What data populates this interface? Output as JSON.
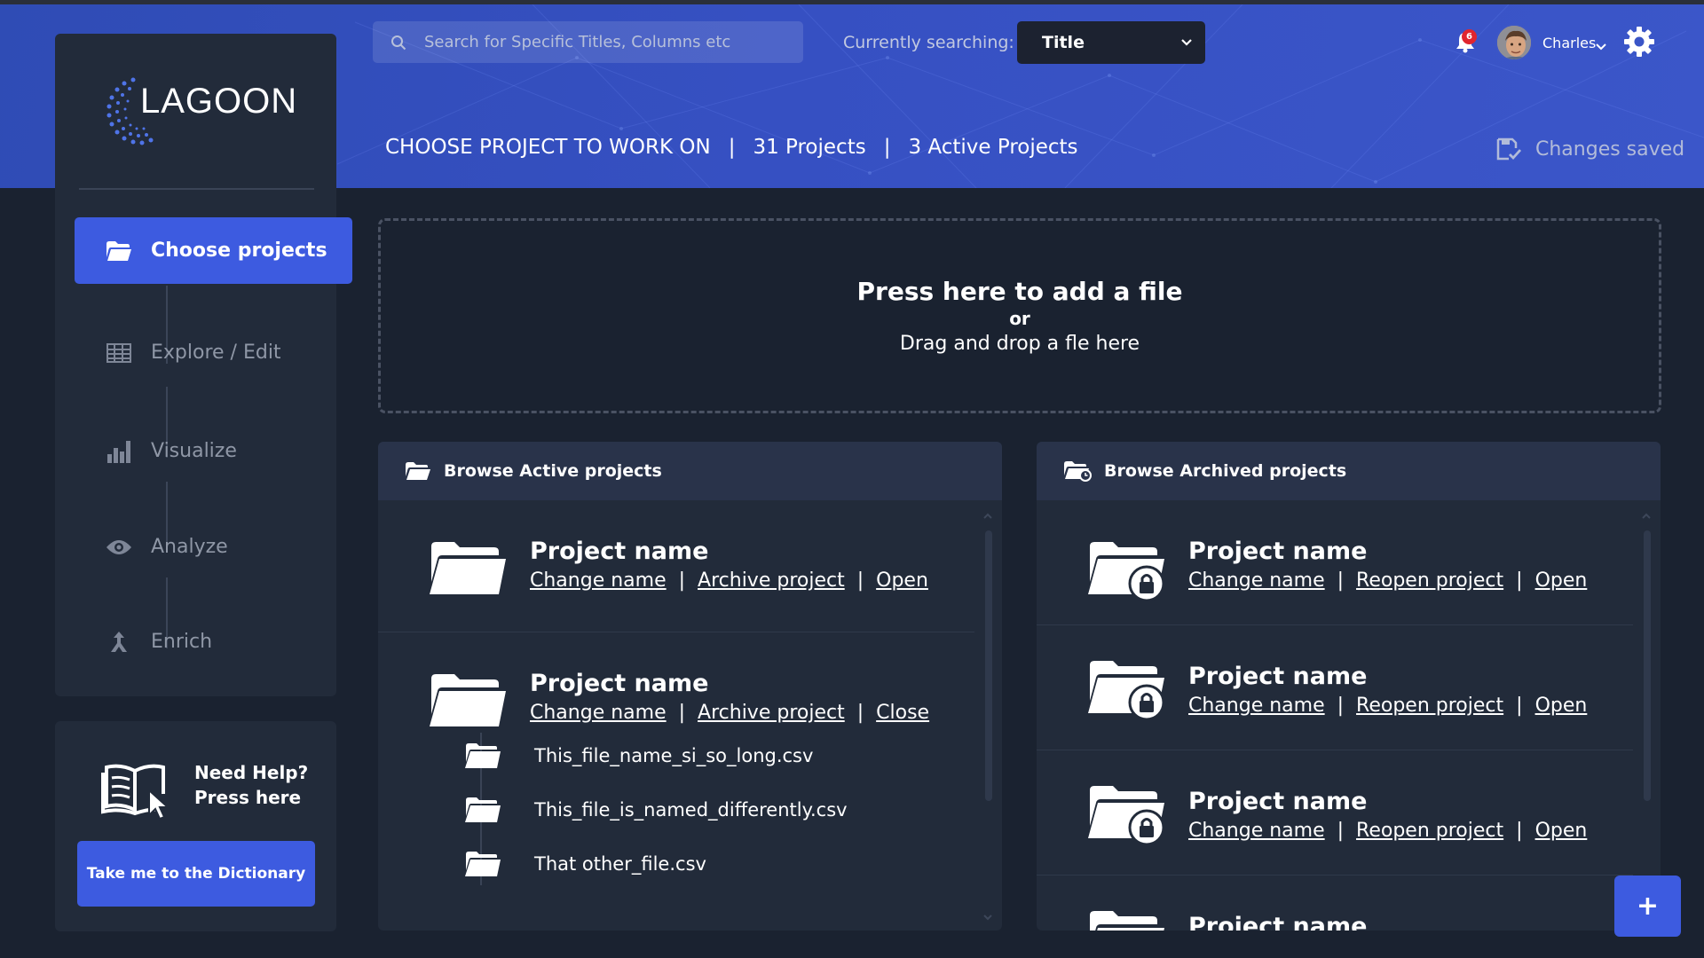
{
  "app": {
    "logo_text": "LAGOON"
  },
  "search": {
    "placeholder": "Search for Specific Titles, Columns etc"
  },
  "search_mode": {
    "label": "Currently searching:",
    "value": "Title"
  },
  "notifications": {
    "count": "6"
  },
  "user": {
    "name": "Charles"
  },
  "breadcrumb": {
    "title": "CHOOSE PROJECT TO WORK ON",
    "projects": "31 Projects",
    "active": "3 Active Projects",
    "separator": "|"
  },
  "status": {
    "saved": "Changes saved"
  },
  "sidebar": {
    "items": [
      {
        "label": "Choose projects",
        "icon": "folder-open-icon",
        "active": true
      },
      {
        "label": "Explore / Edit",
        "icon": "table-icon",
        "active": false
      },
      {
        "label": "Visualize",
        "icon": "bar-chart-icon",
        "active": false
      },
      {
        "label": "Analyze",
        "icon": "eye-icon",
        "active": false
      },
      {
        "label": "Enrich",
        "icon": "merge-icon",
        "active": false
      }
    ]
  },
  "help": {
    "line1": "Need Help?",
    "line2": "Press here",
    "button": "Take me to the Dictionary"
  },
  "dropzone": {
    "title": "Press here to add a file",
    "or": "or",
    "sub": "Drag and drop a fle here"
  },
  "active_panel": {
    "title": "Browse Active projects",
    "projects": [
      {
        "name": "Project name",
        "links": [
          "Change name",
          "Archive project",
          "Open"
        ]
      },
      {
        "name": "Project name",
        "links": [
          "Change name",
          "Archive project",
          "Close"
        ],
        "files": [
          "This_file_name_si_so_long.csv",
          "This_file_is_named_differently.csv",
          "That other_file.csv"
        ]
      }
    ]
  },
  "archived_panel": {
    "title": "Browse Archived projects",
    "projects": [
      {
        "name": "Project name",
        "links": [
          "Change name",
          "Reopen project",
          "Open"
        ]
      },
      {
        "name": "Project name",
        "links": [
          "Change name",
          "Reopen project",
          "Open"
        ]
      },
      {
        "name": "Project name",
        "links": [
          "Change name",
          "Reopen project",
          "Open"
        ]
      },
      {
        "name": "Project name"
      }
    ]
  },
  "fab": {
    "label": "+"
  },
  "colors": {
    "accent": "#3d5be0",
    "header": "#3450c0",
    "background": "#1a2230",
    "panel": "#222b3a",
    "badge": "#e0252f"
  }
}
